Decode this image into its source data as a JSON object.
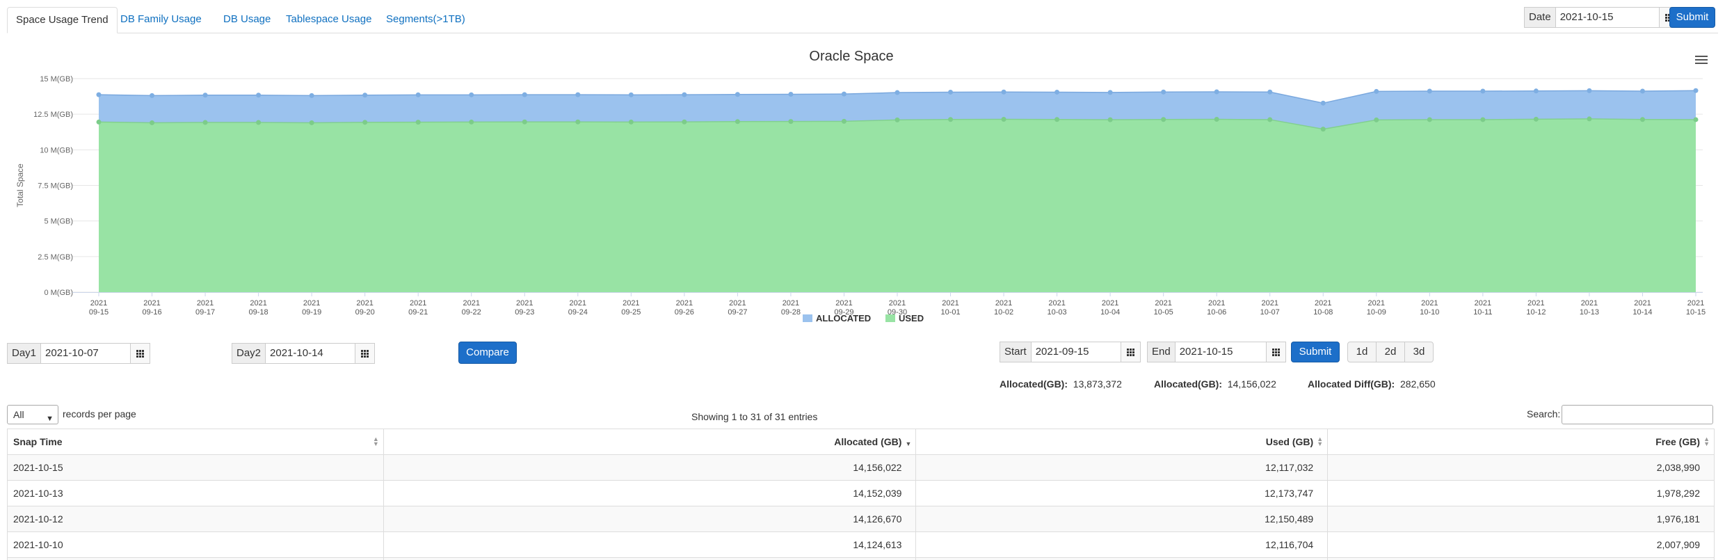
{
  "tabs": [
    {
      "label": "Space Usage Trend",
      "active": true
    },
    {
      "label": "DB Family Usage"
    },
    {
      "label": "DB Usage"
    },
    {
      "label": "Tablespace Usage"
    },
    {
      "label": "Segments(>1TB)"
    }
  ],
  "top_filter": {
    "date_label": "Date",
    "date_value": "2021-10-15",
    "submit_label": "Submit"
  },
  "chart_data": {
    "type": "area",
    "title": "Oracle Space",
    "ylabel": "Total Space",
    "ylim": [
      0,
      15
    ],
    "yticks": [
      "0 M(GB)",
      "2.5 M(GB)",
      "5 M(GB)",
      "7.5 M(GB)",
      "10 M(GB)",
      "12.5 M(GB)",
      "15 M(GB)"
    ],
    "categories": [
      "2021-09-15",
      "2021-09-16",
      "2021-09-17",
      "2021-09-18",
      "2021-09-19",
      "2021-09-20",
      "2021-09-21",
      "2021-09-22",
      "2021-09-23",
      "2021-09-24",
      "2021-09-25",
      "2021-09-26",
      "2021-09-27",
      "2021-09-28",
      "2021-09-29",
      "2021-09-30",
      "2021-10-01",
      "2021-10-02",
      "2021-10-03",
      "2021-10-04",
      "2021-10-05",
      "2021-10-06",
      "2021-10-07",
      "2021-10-08",
      "2021-10-09",
      "2021-10-10",
      "2021-10-11",
      "2021-10-12",
      "2021-10-13",
      "2021-10-14",
      "2021-10-15"
    ],
    "series": [
      {
        "name": "ALLOCATED",
        "color": "#9bc2ee",
        "values": [
          13.87,
          13.81,
          13.84,
          13.84,
          13.81,
          13.84,
          13.86,
          13.86,
          13.87,
          13.87,
          13.86,
          13.87,
          13.89,
          13.9,
          13.92,
          14.02,
          14.05,
          14.06,
          14.05,
          14.03,
          14.06,
          14.07,
          14.06,
          13.28,
          14.1,
          14.12,
          14.12,
          14.13,
          14.15,
          14.12,
          14.16
        ]
      },
      {
        "name": "USED",
        "color": "#98e3a4",
        "values": [
          11.95,
          11.9,
          11.92,
          11.92,
          11.9,
          11.93,
          11.94,
          11.95,
          11.96,
          11.96,
          11.95,
          11.96,
          11.98,
          11.99,
          12.0,
          12.1,
          12.13,
          12.14,
          12.13,
          12.11,
          12.13,
          12.14,
          12.12,
          11.45,
          12.1,
          12.12,
          12.12,
          12.15,
          12.17,
          12.13,
          12.12
        ]
      }
    ],
    "legend": "bottom-center",
    "grid": true
  },
  "compare": {
    "day1_label": "Day1",
    "day1_value": "2021-10-07",
    "day2_label": "Day2",
    "day2_value": "2021-10-14",
    "compare_label": "Compare"
  },
  "range": {
    "start_label": "Start",
    "start_value": "2021-09-15",
    "end_label": "End",
    "end_value": "2021-10-15",
    "submit_label": "Submit",
    "quick": [
      "1d",
      "2d",
      "3d"
    ]
  },
  "summary": {
    "alloc1_label": "Allocated(GB):",
    "alloc1_value": "13,873,372",
    "alloc2_label": "Allocated(GB):",
    "alloc2_value": "14,156,022",
    "diff_label": "Allocated Diff(GB):",
    "diff_value": "282,650"
  },
  "datatable": {
    "length_value": "All",
    "length_suffix": "records per page",
    "info": "Showing 1 to 31 of 31 entries",
    "search_label": "Search:",
    "columns": [
      "Snap Time",
      "Allocated (GB)",
      "Used (GB)",
      "Free (GB)"
    ],
    "rows": [
      [
        "2021-10-15",
        "14,156,022",
        "12,117,032",
        "2,038,990"
      ],
      [
        "2021-10-13",
        "14,152,039",
        "12,173,747",
        "1,978,292"
      ],
      [
        "2021-10-12",
        "14,126,670",
        "12,150,489",
        "1,976,181"
      ],
      [
        "2021-10-10",
        "14,124,613",
        "12,116,704",
        "2,007,909"
      ],
      [
        "",
        "",
        "",
        ""
      ]
    ]
  }
}
